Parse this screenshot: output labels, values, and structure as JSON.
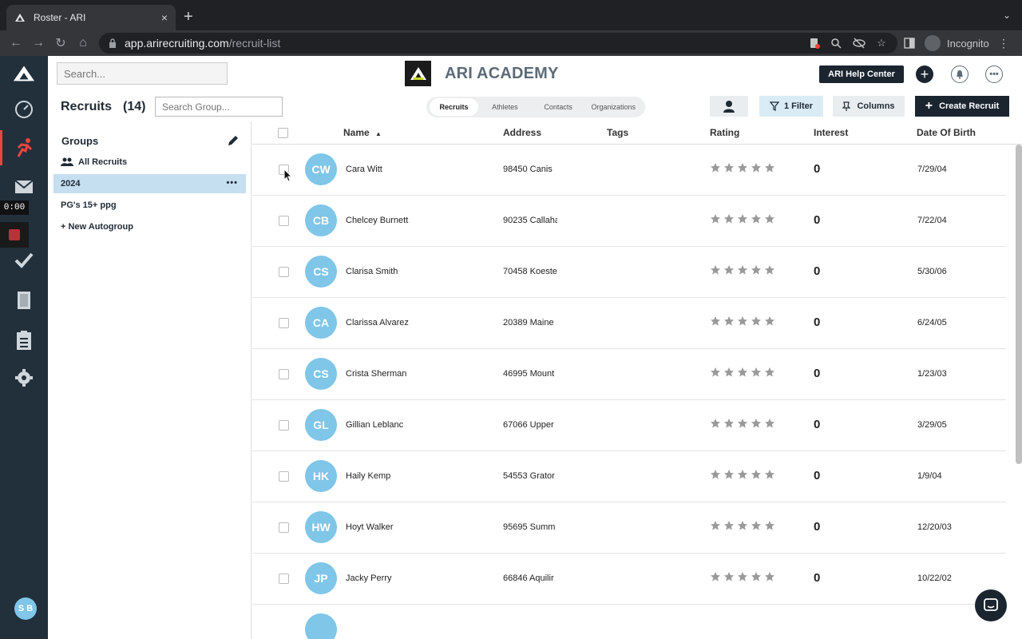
{
  "browser": {
    "tab_title": "Roster - ARI",
    "tab_close": "×",
    "new_tab": "+",
    "url_host": "app.arirecruiting.com",
    "url_path": "/recruit-list",
    "incognito_label": "Incognito"
  },
  "header": {
    "search_placeholder": "Search...",
    "brand_name": "ARI ACADEMY",
    "help_label": "ARI Help Center",
    "plus_label": "+",
    "more_label": "•••"
  },
  "recorder": {
    "timer": "0:00"
  },
  "user": {
    "initials": "S B"
  },
  "subheader": {
    "title": "Recruits",
    "count": "(14)",
    "group_search_placeholder": "Search Group...",
    "tabs": [
      "Recruits",
      "Athletes",
      "Contacts",
      "Organizations"
    ],
    "filter_label": "1 Filter",
    "columns_label": "Columns",
    "create_label": "Create Recruit"
  },
  "groups": {
    "title": "Groups",
    "items": [
      {
        "label": "All Recruits",
        "icon": "users-icon"
      },
      {
        "label": "2024",
        "more": "•••"
      },
      {
        "label": "PG's 15+ ppg"
      },
      {
        "label": "+ New Autogroup"
      }
    ]
  },
  "table": {
    "columns": {
      "name": "Name",
      "sort": "▲",
      "address": "Address",
      "tags": "Tags",
      "rating": "Rating",
      "interest": "Interest",
      "dob": "Date Of Birth"
    },
    "rows": [
      {
        "initials": "CW",
        "name": "Cara Witt",
        "address": "98450 Canis",
        "interest": "0",
        "dob": "7/29/04"
      },
      {
        "initials": "CB",
        "name": "Chelcey Burnett",
        "address": "90235 Callaha",
        "interest": "0",
        "dob": "7/22/04"
      },
      {
        "initials": "CS",
        "name": "Clarisa Smith",
        "address": "70458 Koeste",
        "interest": "0",
        "dob": "5/30/06"
      },
      {
        "initials": "CA",
        "name": "Clarissa Alvarez",
        "address": "20389 Maine",
        "interest": "0",
        "dob": "6/24/05"
      },
      {
        "initials": "CS",
        "name": "Crista Sherman",
        "address": "46995 Mount",
        "interest": "0",
        "dob": "1/23/03"
      },
      {
        "initials": "GL",
        "name": "Gillian Leblanc",
        "address": "67066 Upper",
        "interest": "0",
        "dob": "3/29/05"
      },
      {
        "initials": "HK",
        "name": "Haily Kemp",
        "address": "54553 Grator",
        "interest": "0",
        "dob": "1/9/04"
      },
      {
        "initials": "HW",
        "name": "Hoyt Walker",
        "address": "95695 Summ",
        "interest": "0",
        "dob": "12/20/03"
      },
      {
        "initials": "JP",
        "name": "Jacky Perry",
        "address": "66846 Aquilir",
        "interest": "0",
        "dob": "10/22/02"
      },
      {
        "initials": "",
        "name": "",
        "address": "",
        "interest": "",
        "dob": ""
      }
    ]
  },
  "colors": {
    "nav_bg": "#22303c",
    "accent_red": "#e9463d",
    "avatar_blue": "#7fc6e8",
    "dark_button": "#1b2530",
    "group_active": "#c5def0"
  }
}
